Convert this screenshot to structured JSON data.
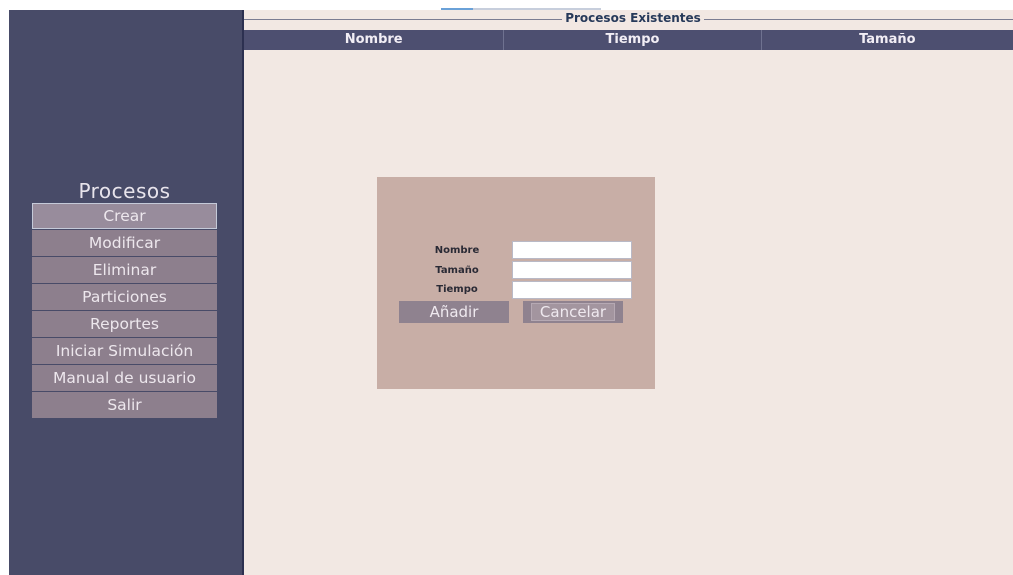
{
  "sidebar": {
    "title": "Procesos",
    "items": [
      {
        "label": "Crear"
      },
      {
        "label": "Modificar"
      },
      {
        "label": "Eliminar"
      },
      {
        "label": "Particiones"
      },
      {
        "label": "Reportes"
      },
      {
        "label": "Iniciar Simulación"
      },
      {
        "label": "Manual de usuario"
      },
      {
        "label": "Salir"
      }
    ]
  },
  "main": {
    "panel_title": "Procesos Existentes",
    "columns": [
      "Nombre",
      "Tiempo",
      "Tamaño"
    ],
    "rows": []
  },
  "dialog": {
    "fields": {
      "nombre": {
        "label": "Nombre",
        "value": ""
      },
      "tamano": {
        "label": "Tamaño",
        "value": ""
      },
      "tiempo": {
        "label": "Tiempo",
        "value": ""
      }
    },
    "add_label": "Añadir",
    "cancel_label": "Cancelar"
  },
  "colors": {
    "sidebar": "#484b68",
    "menu_item": "#8d7f8d",
    "table_header": "#4d4f70",
    "content_bg": "#f2e8e3",
    "dialog_bg": "#c8aea6",
    "title_text": "#273a5a"
  }
}
